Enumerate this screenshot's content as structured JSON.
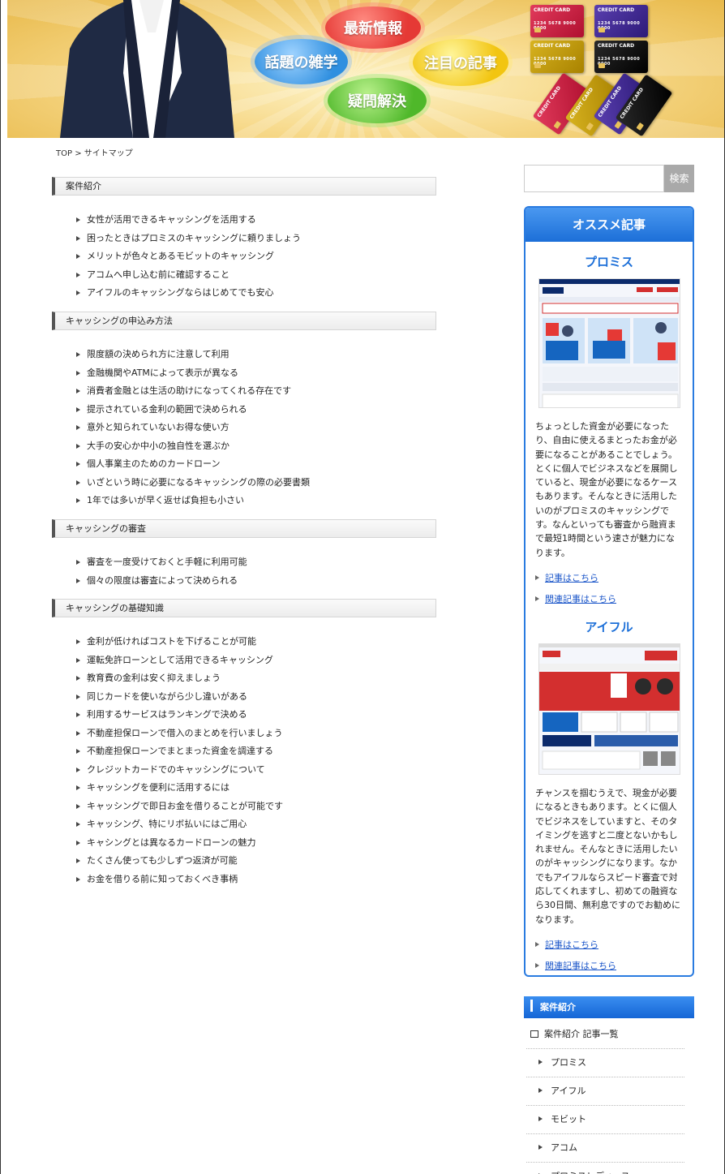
{
  "header": {
    "bubbles": {
      "news": "最新情報",
      "trivia": "話題の雑学",
      "featured": "注目の記事",
      "qa": "疑問解決"
    },
    "card_label": "CREDIT CARD",
    "card_number": "1234 5678 9000 0000"
  },
  "breadcrumb": "TOP > サイトマップ",
  "sections": [
    {
      "title": "案件紹介",
      "items": [
        "女性が活用できるキャッシングを活用する",
        "困ったときはプロミスのキャッシングに頼りましょう",
        "メリットが色々とあるモビットのキャッシング",
        "アコムへ申し込む前に確認すること",
        "アイフルのキャッシングならはじめてでも安心"
      ]
    },
    {
      "title": "キャッシングの申込み方法",
      "items": [
        "限度額の決められ方に注意して利用",
        "金融機関やATMによって表示が異なる",
        "消費者金融とは生活の助けになってくれる存在です",
        "提示されている金利の範囲で決められる",
        "意外と知られていないお得な使い方",
        "大手の安心か中小の独自性を選ぶか",
        "個人事業主のためのカードローン",
        "いざという時に必要になるキャッシングの際の必要書類",
        "1年では多いが早く返せば負担も小さい"
      ]
    },
    {
      "title": "キャッシングの審査",
      "items": [
        "審査を一度受けておくと手軽に利用可能",
        "個々の限度は審査によって決められる"
      ]
    },
    {
      "title": "キャッシングの基礎知識",
      "items": [
        "金利が低ければコストを下げることが可能",
        "運転免許ローンとして活用できるキャッシング",
        "教育費の金利は安く抑えましょう",
        "同じカードを使いながら少し違いがある",
        "利用するサービスはランキングで決める",
        "不動産担保ローンで借入のまとめを行いましょう",
        "不動産担保ローンでまとまった資金を調達する",
        "クレジットカードでのキャッシングについて",
        "キャッシングを便利に活用するには",
        "キャッシングで即日お金を借りることが可能です",
        "キャッシング、特にリボ払いにはご用心",
        "キャシングとは異なるカードローンの魅力",
        "たくさん使っても少しずつ返済が可能",
        "お金を借りる前に知っておくべき事柄"
      ]
    }
  ],
  "search": {
    "button_label": "検索",
    "placeholder": ""
  },
  "recommend": {
    "heading": "オススメ記事",
    "entries": [
      {
        "title": "プロミス",
        "text": "ちょっとした資金が必要になったり、自由に使えるまとったお金が必要になることがあることでしょう。とくに個人でビジネスなどを展開していると、現金が必要になるケースもあります。そんなときに活用したいのがプロミスのキャッシングです。なんといっても審査から融資まで最短1時間という速さが魅力になります。",
        "link_article": "記事はこちら",
        "link_related": "関連記事はこちら"
      },
      {
        "title": "アイフル",
        "text": "チャンスを掴むうえで、現金が必要になるときもあります。とくに個人でビジネスをしていますと、そのタイミングを逃すと二度とないかもしれません。そんなときに活用したいのがキャッシングになります。なかでもアイフルならスピード審査で対応してくれますし、初めての融資なら30日間、無利息ですのでお勧めになります。",
        "link_article": "記事はこちら",
        "link_related": "関連記事はこちら"
      }
    ]
  },
  "category": {
    "heading": "案件紹介",
    "all_label": "案件紹介 記事一覧",
    "items": [
      "プロミス",
      "アイフル",
      "モビット",
      "アコム",
      "プロミスレディース"
    ]
  },
  "colors": {
    "accent_blue": "#1c6fd8",
    "link_blue": "#1a55c9",
    "news_red": "#e53935",
    "trivia_blue": "#2f8fe0",
    "featured_yellow": "#f2c511",
    "qa_green": "#4fb82a"
  }
}
